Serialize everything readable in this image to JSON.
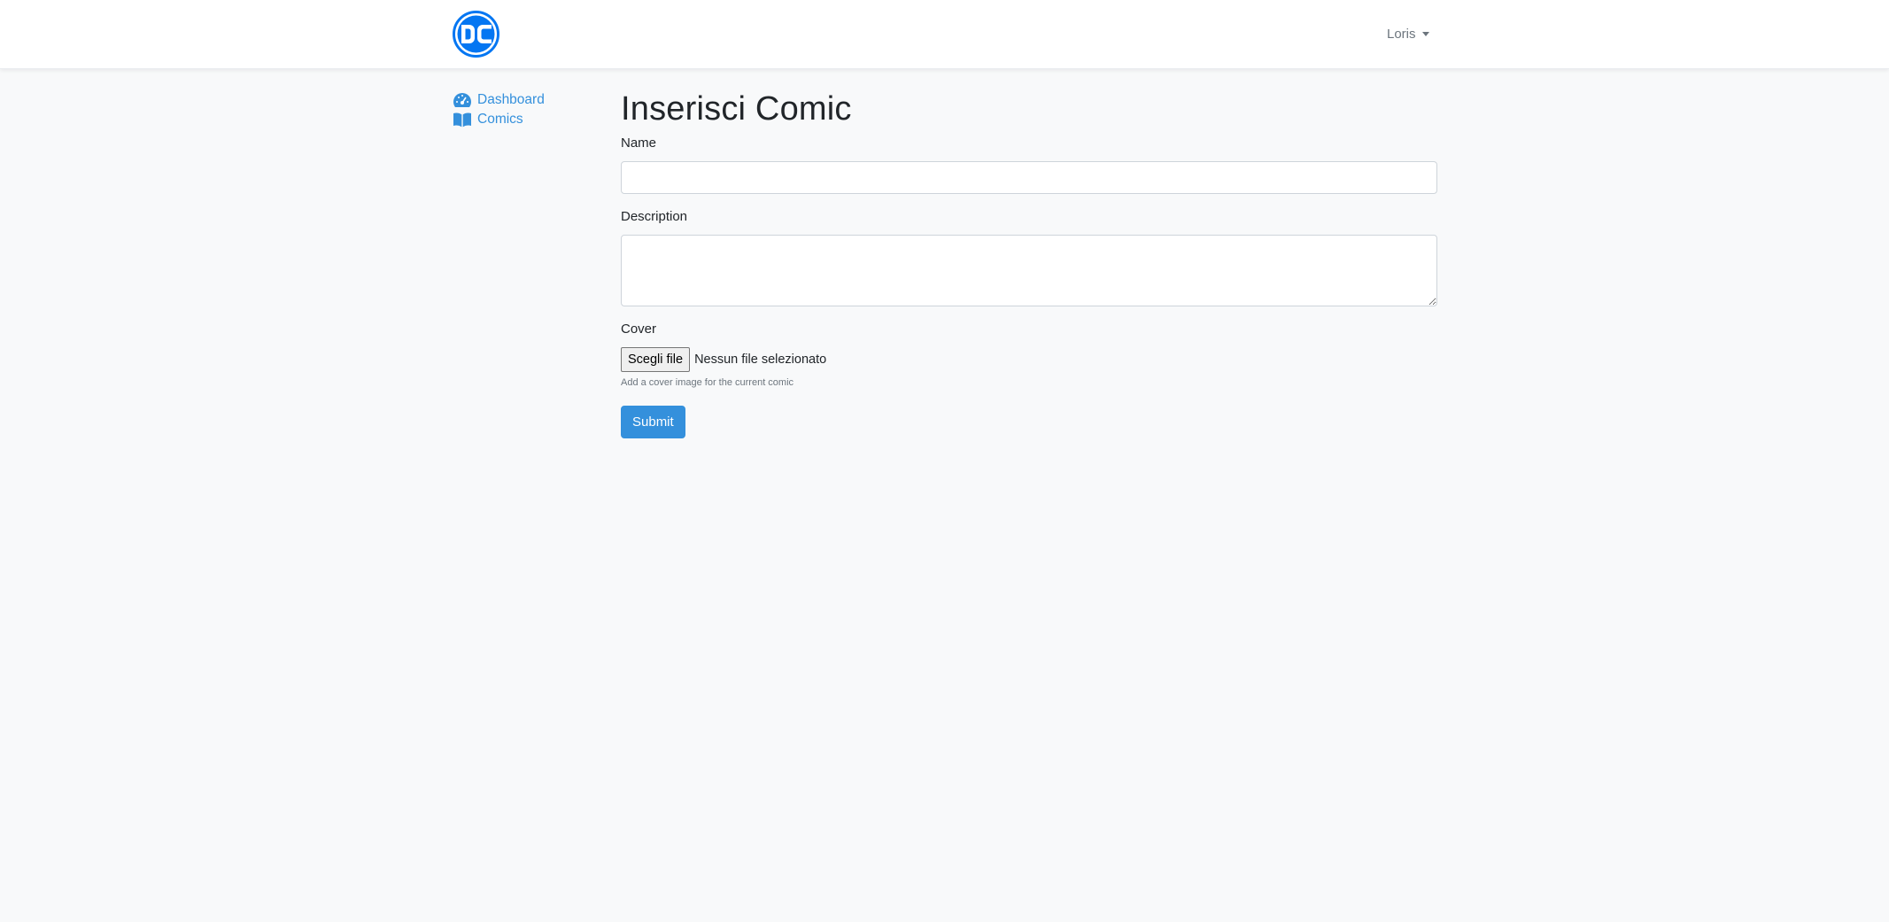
{
  "header": {
    "logo_text": "DC",
    "user_name": "Loris"
  },
  "sidebar": {
    "items": [
      {
        "label": "Dashboard",
        "icon": "tachometer-icon"
      },
      {
        "label": "Comics",
        "icon": "book-open-icon"
      }
    ]
  },
  "form": {
    "title": "Inserisci Comic",
    "name_label": "Name",
    "name_value": "",
    "description_label": "Description",
    "description_value": "",
    "cover_label": "Cover",
    "file_button_label": "Scegli file",
    "file_status": "Nessun file selezionato",
    "cover_help": "Add a cover image for the current comic",
    "submit_label": "Submit"
  },
  "colors": {
    "accent": "#3490dc",
    "background": "#f8f9fa",
    "navbar": "#ffffff"
  }
}
